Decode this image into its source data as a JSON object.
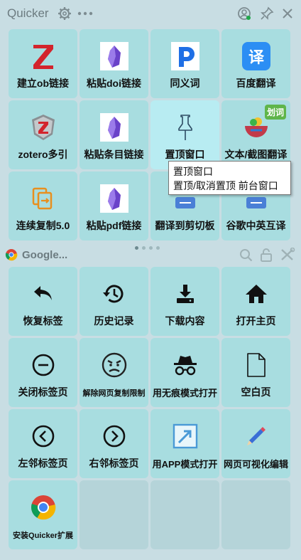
{
  "header": {
    "title": "Quicker"
  },
  "panel1": {
    "items": [
      {
        "label": "建立ob链接",
        "icon": "zotero-z-icon"
      },
      {
        "label": "粘贴doi链接",
        "icon": "obsidian-icon"
      },
      {
        "label": "同义词",
        "icon": "p-logo-icon"
      },
      {
        "label": "百度翻译",
        "icon": "baidu-translate-icon"
      },
      {
        "label": "zotero多引",
        "icon": "zotero-shield-icon"
      },
      {
        "label": "粘贴条目链接",
        "icon": "obsidian-icon"
      },
      {
        "label": "置顶窗口",
        "icon": "pin-icon"
      },
      {
        "label": "文本/截图翻译",
        "icon": "translate-bowl-icon",
        "badge": "划词"
      },
      {
        "label": "连续复制5.0",
        "icon": "copy-icon"
      },
      {
        "label": "粘贴pdf链接",
        "icon": "obsidian-icon"
      },
      {
        "label": "翻译到剪切板",
        "icon": "translate-clipboard-icon"
      },
      {
        "label": "谷歌中英互译",
        "icon": "google-translate-icon"
      }
    ]
  },
  "tooltip": {
    "line1": "置顶窗口",
    "line2": "置顶/取消置顶 前台窗口"
  },
  "panel2": {
    "title": "Google...",
    "items": [
      {
        "label": "恢复标签",
        "icon": "reply-arrow-icon"
      },
      {
        "label": "历史记录",
        "icon": "history-icon"
      },
      {
        "label": "下载内容",
        "icon": "download-icon"
      },
      {
        "label": "打开主页",
        "icon": "home-icon"
      },
      {
        "label": "关闭标签页",
        "icon": "minus-circle-icon"
      },
      {
        "label": "解除网页复制限制",
        "icon": "angry-face-icon"
      },
      {
        "label": "用无痕模式打开",
        "icon": "incognito-icon"
      },
      {
        "label": "空白页",
        "icon": "blank-page-icon"
      },
      {
        "label": "左邻标签页",
        "icon": "chevron-left-circle-icon"
      },
      {
        "label": "右邻标签页",
        "icon": "chevron-right-circle-icon"
      },
      {
        "label": "用APP模式打开",
        "icon": "open-app-icon"
      },
      {
        "label": "网页可视化编辑",
        "icon": "pencil-icon"
      },
      {
        "label": "安装Quicker扩展",
        "icon": "chrome-icon"
      }
    ]
  }
}
